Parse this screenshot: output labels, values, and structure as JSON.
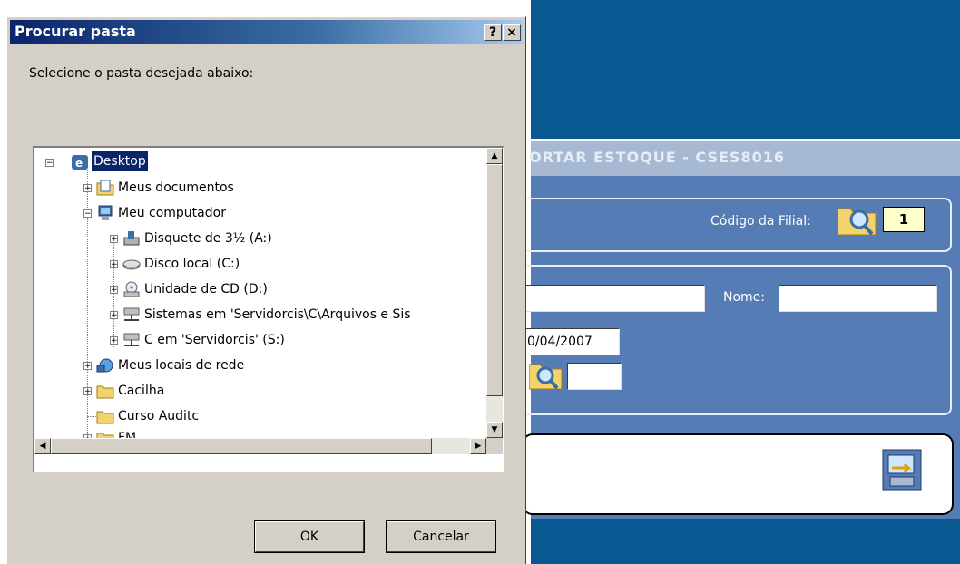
{
  "dialog": {
    "title": "Procurar pasta",
    "help_button": "?",
    "close_button": "×",
    "prompt": "Selecione o pasta desejada abaixo:",
    "ok_label": "OK",
    "cancel_label": "Cancelar"
  },
  "tree": {
    "items": [
      {
        "label": "Desktop",
        "icon": "desktop-icon",
        "selected": true
      },
      {
        "label": "Meus documentos",
        "icon": "documents-icon"
      },
      {
        "label": "Meu computador",
        "icon": "computer-icon"
      },
      {
        "label": "Disquete de 3½ (A:)",
        "icon": "floppy-icon"
      },
      {
        "label": "Disco local (C:)",
        "icon": "harddisk-icon"
      },
      {
        "label": "Unidade de CD (D:)",
        "icon": "cd-drive-icon"
      },
      {
        "label": "Sistemas em 'Servidorcis\\C\\Arquivos e Sis",
        "icon": "network-drive-icon"
      },
      {
        "label": "C em 'Servidorcis' (S:)",
        "icon": "network-drive-icon"
      },
      {
        "label": "Meus locais de rede",
        "icon": "network-places-icon"
      },
      {
        "label": "Cacilha",
        "icon": "folder-icon"
      },
      {
        "label": "Curso Auditc",
        "icon": "folder-icon"
      },
      {
        "label": "FM",
        "icon": "folder-icon"
      }
    ]
  },
  "background_app": {
    "title": "ORTAR ESTOQUE  -  CSES8016",
    "codigo_filial_label": "Código da Filial:",
    "codigo_filial_value": "1",
    "nome_label": "Nome:",
    "date_value": "0/04/2007"
  }
}
